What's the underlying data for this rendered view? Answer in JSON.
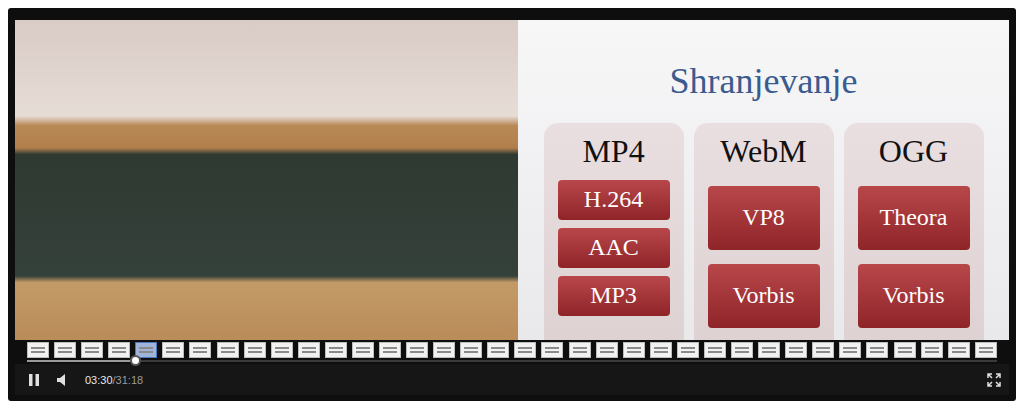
{
  "player": {
    "playing": true,
    "muted": false,
    "current_time": "03:30",
    "duration": "/31:18",
    "level": 0.112
  },
  "slide": {
    "title": "Shranjevanje",
    "columns": [
      {
        "name": "MP4",
        "codecs": [
          "H.264",
          "AAC",
          "MP3"
        ]
      },
      {
        "name": "WebM",
        "codecs": [
          "VP8",
          "Vorbis"
        ]
      },
      {
        "name": "OGG",
        "codecs": [
          "Theora",
          "Vorbis"
        ]
      }
    ]
  },
  "thumbnails": [
    {
      "selected": false
    },
    {
      "selected": false
    },
    {
      "selected": false
    },
    {
      "selected": false
    },
    {
      "selected": true
    },
    {
      "selected": false
    },
    {
      "selected": false
    },
    {
      "selected": false
    },
    {
      "selected": false
    },
    {
      "selected": false
    },
    {
      "selected": false
    },
    {
      "selected": false
    },
    {
      "selected": false
    },
    {
      "selected": false
    },
    {
      "selected": false
    },
    {
      "selected": false
    },
    {
      "selected": false
    },
    {
      "selected": false
    },
    {
      "selected": false
    },
    {
      "selected": false
    },
    {
      "selected": false
    },
    {
      "selected": false
    },
    {
      "selected": false
    },
    {
      "selected": false
    },
    {
      "selected": false
    },
    {
      "selected": false
    },
    {
      "selected": false
    },
    {
      "selected": false
    },
    {
      "selected": false
    },
    {
      "selected": false
    },
    {
      "selected": false
    },
    {
      "selected": false
    },
    {
      "selected": false
    },
    {
      "selected": false
    },
    {
      "selected": false
    },
    {
      "selected": false
    }
  ]
}
